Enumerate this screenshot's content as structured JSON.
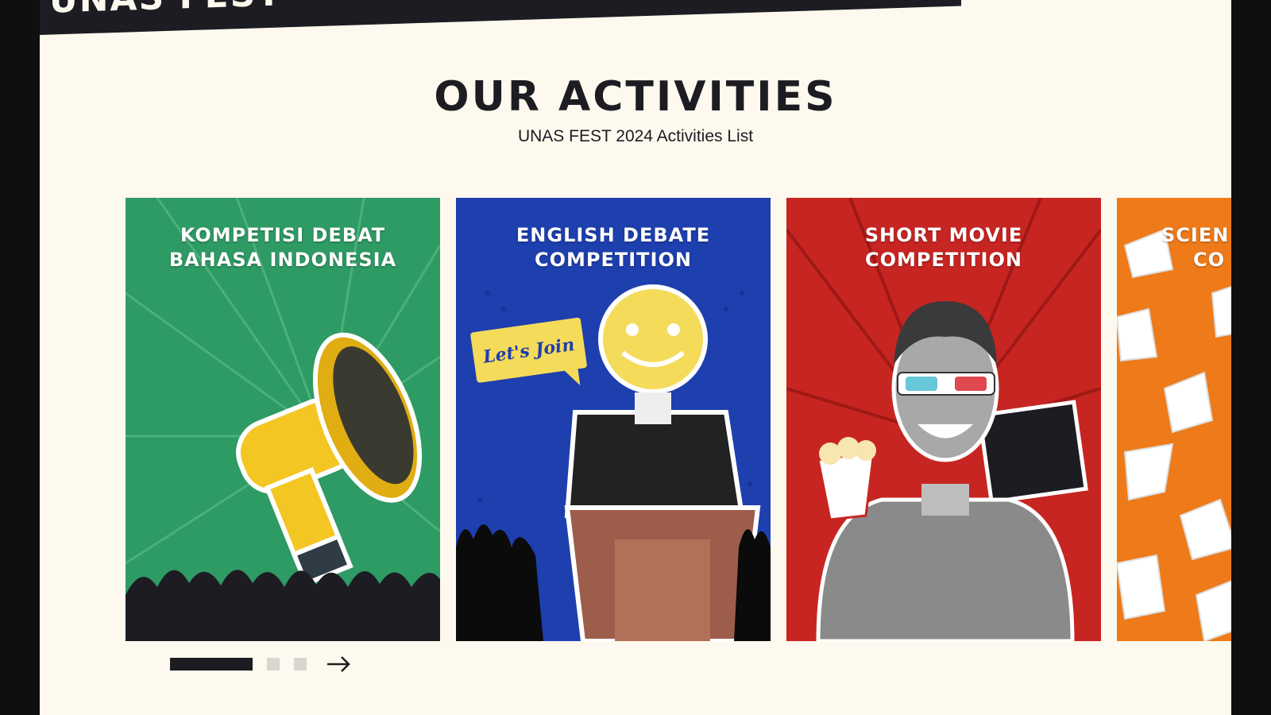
{
  "banner": {
    "text": "UNAS FEST"
  },
  "section": {
    "title": "OUR ACTIVITIES",
    "subtitle": "UNAS FEST 2024 Activities List"
  },
  "cards": [
    {
      "line1": "KOMPETISI DEBAT",
      "line2": "BAHASA INDONESIA",
      "color": "#2e9a64"
    },
    {
      "line1": "ENGLISH DEBATE",
      "line2": "COMPETITION",
      "color": "#1e3fae"
    },
    {
      "line1": "SHORT MOVIE",
      "line2": "COMPETITION",
      "color": "#c72522"
    },
    {
      "line1": "SCIEN",
      "line2": "CO",
      "color": "#ee7a1a"
    }
  ],
  "speech_bubble": "Let's Join",
  "pagination": {
    "active_index": 0,
    "count": 3
  },
  "colors": {
    "dark": "#1c1c22",
    "cream": "#fdf9ee",
    "dot_inactive": "#d9d6cf"
  }
}
